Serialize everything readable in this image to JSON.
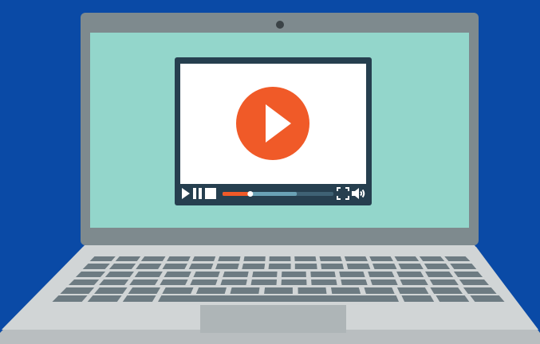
{
  "colors": {
    "background": "#0a4aa6",
    "lid_bezel": "#7e8a8e",
    "webcam": "#3b4347",
    "screen": "#93d6cb",
    "player_frame": "#263f4f",
    "player_video": "#ffffff",
    "play_button": "#f05a28",
    "progress_played": "#f05a28",
    "progress_buffered": "#6aa2b6",
    "progress_track": "#3f6274",
    "controls_icons": "#ffffff",
    "laptop_base": "#d1d5d6",
    "laptop_base_edge": "#b9bec0",
    "keys": "#6d7b82",
    "touchpad": "#aeb5b7"
  },
  "player": {
    "progress_played": 0.25,
    "progress_buffered": 0.67
  },
  "icons": {
    "big_play": "play-icon",
    "controls": [
      "play-icon",
      "pause-icon",
      "stop-icon",
      "fullscreen-icon",
      "volume-icon"
    ]
  }
}
